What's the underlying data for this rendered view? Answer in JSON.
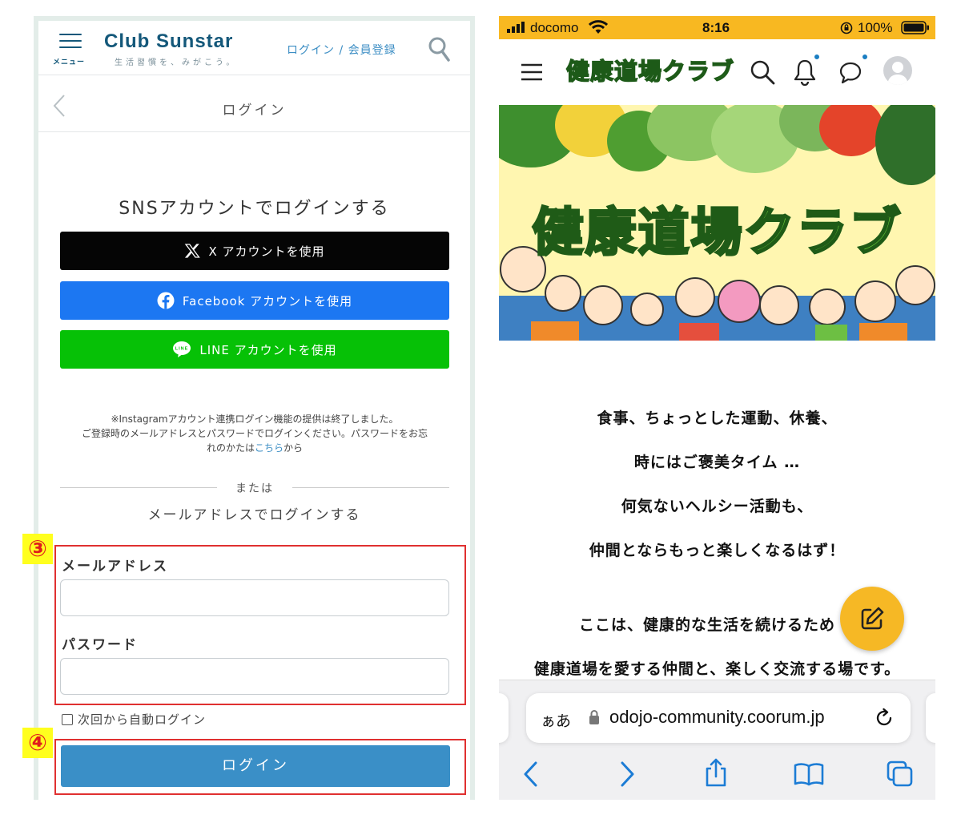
{
  "left": {
    "header": {
      "menu_label": "メニュー",
      "brand": "Club Sunstar",
      "tagline": "生活習慣を、みがこう。",
      "login_register": "ログイン / 会員登録"
    },
    "subbar": {
      "title": "ログイン"
    },
    "sns": {
      "title": "SNSアカウントでログインする",
      "x_label": "X アカウントを使用",
      "facebook_label": "Facebook アカウントを使用",
      "line_label": "LINE アカウントを使用"
    },
    "notice": {
      "line1": "※Instagramアカウント連携ログイン機能の提供は終了しました。",
      "line2": "ご登録時のメールアドレスとパスワードでログインください。パスワードをお忘",
      "line3_prefix": "れのかたは",
      "line3_link": "こちら",
      "line3_suffix": "から"
    },
    "divider": "または",
    "mail_title": "メールアドレスでログインする",
    "badge3": "③",
    "badge4": "④",
    "email_label": "メールアドレス",
    "email_value": "",
    "password_label": "パスワード",
    "password_value": "",
    "auto_login": "次回から自動ログイン",
    "login_button": "ログイン"
  },
  "right": {
    "status": {
      "carrier": "docomo",
      "time": "8:16",
      "battery": "100%"
    },
    "logo": "健康道場クラブ",
    "banner_title": "健康道場クラブ",
    "body": [
      "食事、ちょっとした運動、休養、",
      "時にはご褒美タイム …",
      "何気ないヘルシー活動も、",
      "仲間とならもっと楽しくなるはず！",
      "ここは、健康的な生活を続けるため",
      "健康道場を愛する仲間と、楽しく交流する場です。"
    ],
    "browser": {
      "aa": "ぁあ",
      "url": "odojo-community.coorum.jp"
    }
  },
  "colors": {
    "sunstar_blue": "#14587a",
    "link_blue": "#3c8ec4",
    "facebook": "#1c77f2",
    "line": "#06c106",
    "login_button": "#3a8fc7",
    "status_bar": "#f8b821",
    "annotation_red": "#e03030",
    "annotation_yellow": "#ffff1e"
  }
}
